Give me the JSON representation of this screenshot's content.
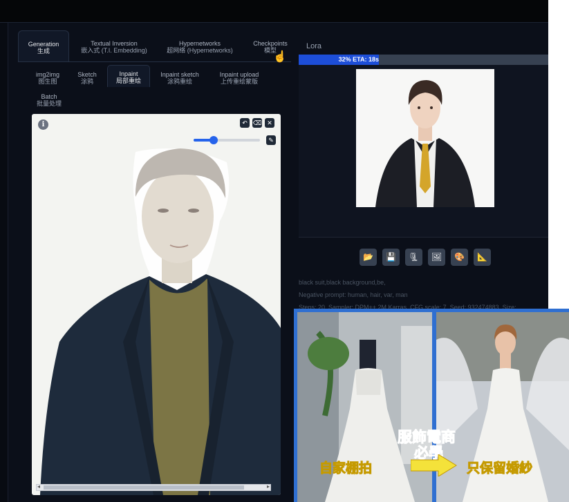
{
  "tabs": [
    {
      "label": "Generation",
      "sub": "生成"
    },
    {
      "label": "Textual Inversion",
      "sub": "嵌入式 (T.I. Embedding)"
    },
    {
      "label": "Hypernetworks",
      "sub": "超网络 (Hypernetworks)"
    },
    {
      "label": "Checkpoints",
      "sub": "模型"
    }
  ],
  "lora_tab": "Lora",
  "subtabs": [
    {
      "label": "img2img",
      "sub": "图生图"
    },
    {
      "label": "Sketch",
      "sub": "涂鸦"
    },
    {
      "label": "Inpaint",
      "sub": "局部重绘"
    },
    {
      "label": "Inpaint sketch",
      "sub": "涂鸦重绘"
    },
    {
      "label": "Inpaint upload",
      "sub": "上传重绘蒙版"
    },
    {
      "label": "Batch",
      "sub": "批量处理"
    }
  ],
  "canvas": {
    "info_icon": "info-icon",
    "tools": [
      "undo-icon",
      "clear-icon",
      "close-icon"
    ],
    "brush_size": 0.3
  },
  "progress": {
    "text": "32% ETA: 18s",
    "fraction": 0.32
  },
  "actions": [
    "folder-icon",
    "save-icon",
    "zip-icon",
    "image-icon",
    "palette-icon",
    "ruler-icon"
  ],
  "generation_info": [
    "black suit,black background,be,",
    "Negative prompt: human, hair, var, man",
    "Steps: 20, Sampler: DPM++ 2M Karras, CFG scale: 7, Seed: 932474883, Size:"
  ],
  "overlay": {
    "title_line1": "服飾電商",
    "title_line2": "必學",
    "left_caption": "自家棚拍",
    "right_caption": "只保留婚紗"
  }
}
